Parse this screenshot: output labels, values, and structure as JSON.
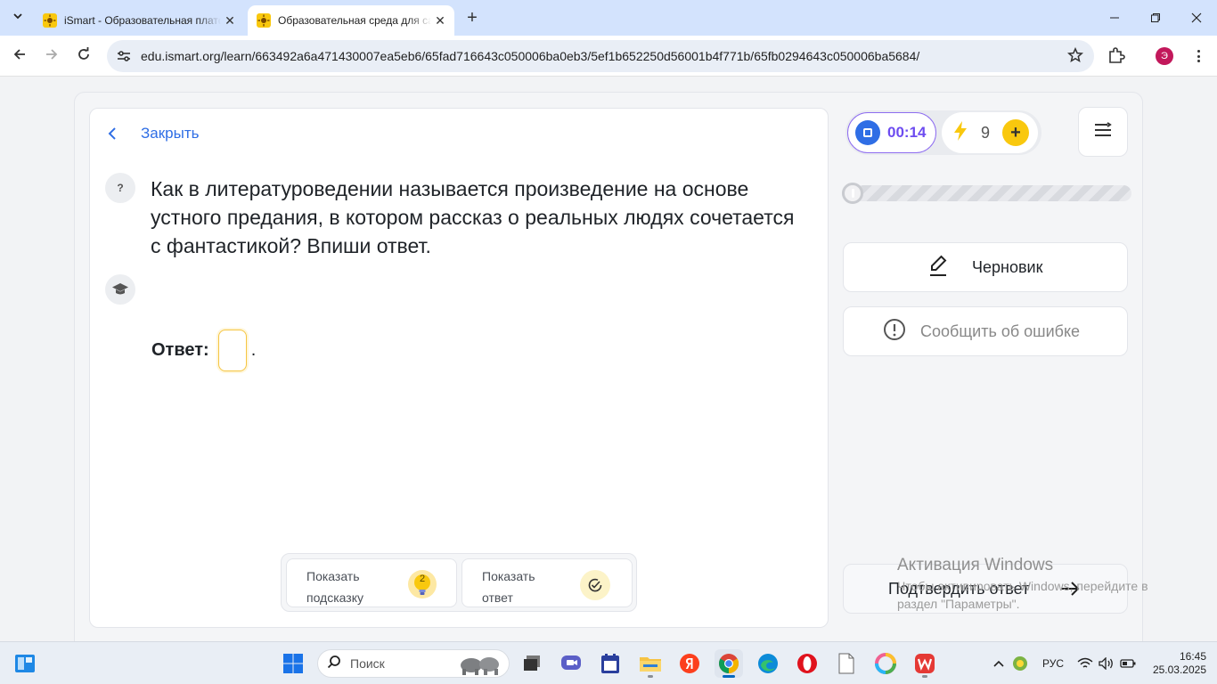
{
  "browser": {
    "tabs": [
      {
        "title": "iSmart - Образовательная платформа",
        "active": false
      },
      {
        "title": "Образовательная среда для самостоятельного обучения",
        "active": true
      }
    ],
    "url": "edu.ismart.org/learn/663492a6a471430007ea5eb6/65fad716643c050006ba0eb3/5ef1b652250d56001b4f771b/65fb0294643c050006ba5684/",
    "profile_initial": "Э",
    "icons": {
      "tab_search": "chevron-down-icon",
      "favicon": "ismart-sun-icon",
      "new_tab": "plus-icon",
      "back": "arrow-left-icon",
      "forward": "arrow-right-icon",
      "reload": "reload-icon",
      "site_info": "tune-icon",
      "bookmark": "star-icon",
      "extensions": "puzzle-icon",
      "menu": "more-vertical-icon"
    }
  },
  "page": {
    "close_label": "Закрыть",
    "question_badge": "?",
    "question_text": "Как в литературоведении называется произведение на основе устного предания, в котором рассказ о реальных людях сочетается с фантастикой? Впиши ответ.",
    "answer_label": "Ответ:",
    "answer_value": "",
    "answer_suffix": ".",
    "hint_button_label": "Показать подсказку",
    "hints_remaining": "2",
    "show_answer_label": "Показать ответ"
  },
  "sidebar": {
    "timer": "00:14",
    "energy": "9",
    "progress": 0,
    "draft_label": "Черновик",
    "report_label": "Сообщить об ошибке",
    "submit_label": "Подтвердить ответ"
  },
  "watermark": {
    "title": "Активация Windows",
    "subtitle": "Чтобы активировать Windows, перейдите в раздел \"Параметры\"."
  },
  "taskbar": {
    "search_placeholder": "Поиск",
    "language": "РУС",
    "time": "16:45",
    "date": "25.03.2025"
  },
  "colors": {
    "accent_blue": "#2f6ee5",
    "timer_purple": "#6d4cf0",
    "energy_yellow": "#f9c80e",
    "input_border": "#f5c542"
  }
}
